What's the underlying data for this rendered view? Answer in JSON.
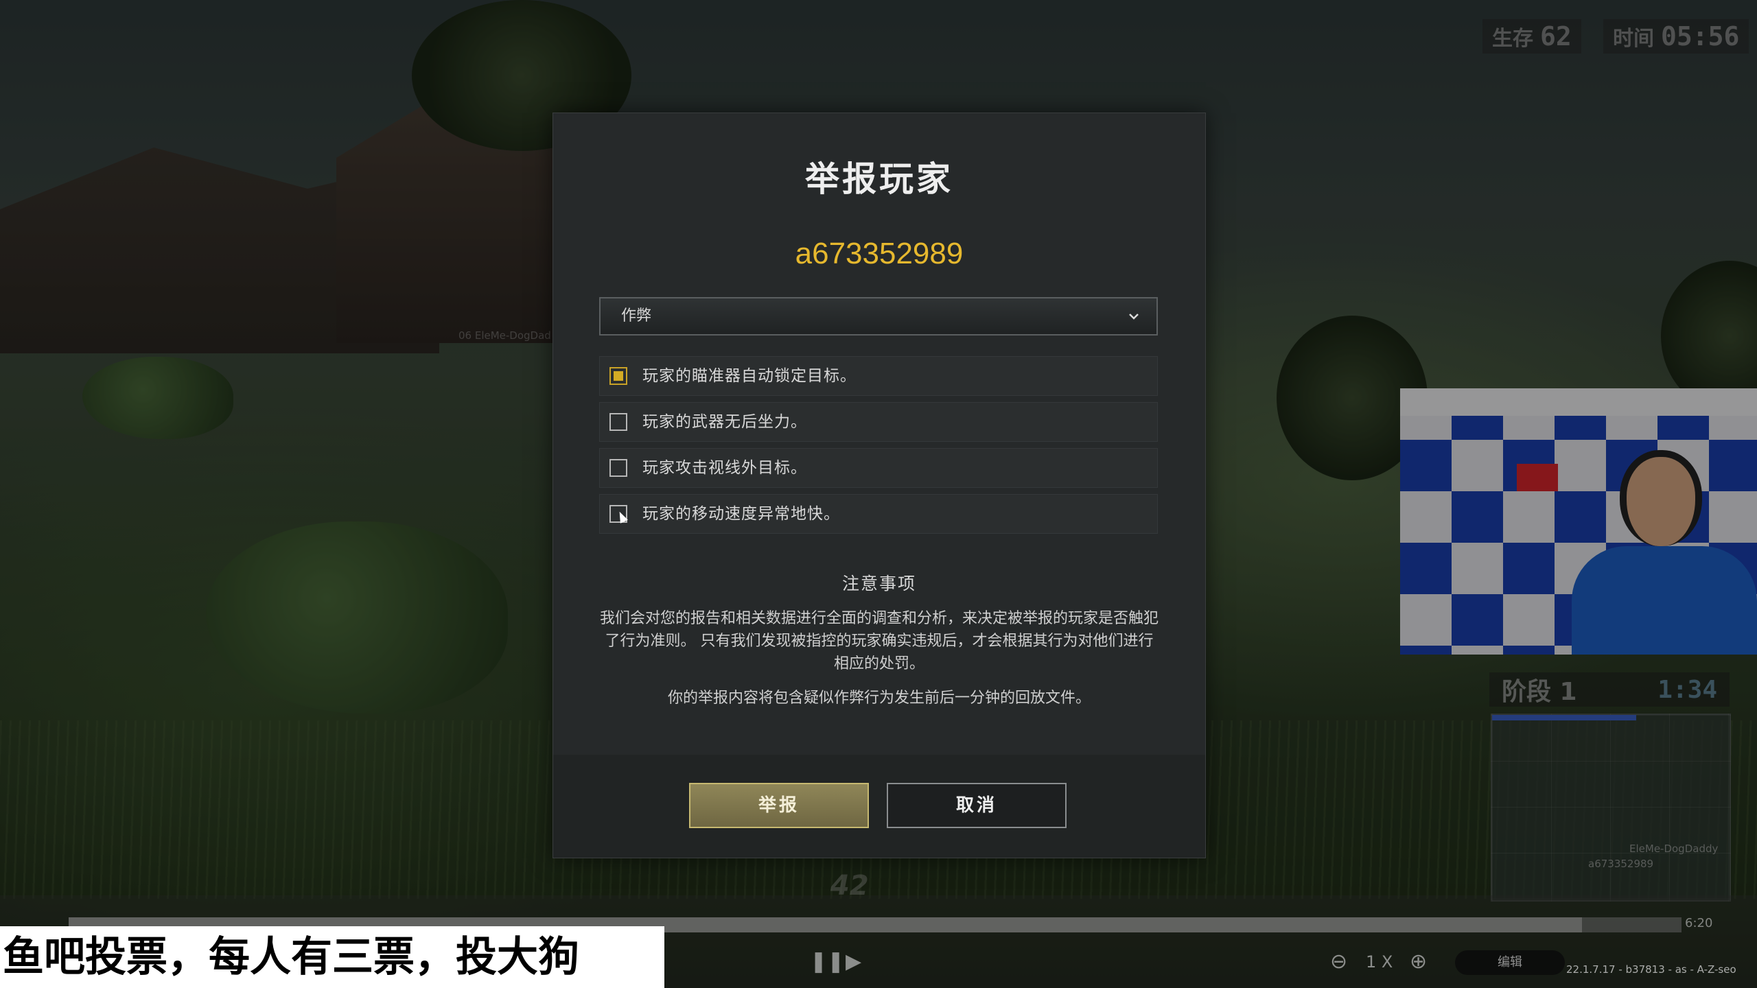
{
  "hud": {
    "alive_label": "生存",
    "alive_count": "62",
    "time_label": "时间",
    "time_value": "05:56",
    "teammate_name": "06  EleMe-DogDad",
    "ammo": "42"
  },
  "minimap": {
    "phase_label": "阶段 1",
    "phase_time": "1:34",
    "player_label_1": "EleMe-DogDaddy",
    "player_label_2": "a673352989"
  },
  "replay": {
    "end_time": "6:20",
    "zoom_label": "1 X",
    "edit_button": "编辑",
    "version": "22.1.7.17 - b37813 - as - A-Z-seo"
  },
  "caption": "鱼吧投票，每人有三票，投大狗",
  "report_dialog": {
    "title": "举报玩家",
    "player_name": "a673352989",
    "category": "作弊",
    "options": [
      {
        "label": "玩家的瞄准器自动锁定目标。",
        "checked": true
      },
      {
        "label": "玩家的武器无后坐力。",
        "checked": false
      },
      {
        "label": "玩家攻击视线外目标。",
        "checked": false
      },
      {
        "label": "玩家的移动速度异常地快。",
        "checked": false
      }
    ],
    "notice_title": "注意事项",
    "notice_body": "我们会对您的报告和相关数据进行全面的调查和分析，来决定被举报的玩家是否触犯了行为准则。 只有我们发现被指控的玩家确实违规后，才会根据其行为对他们进行相应的处罚。",
    "notice_extra": "你的举报内容将包含疑似作弊行为发生前后一分钟的回放文件。",
    "report_button": "举报",
    "cancel_button": "取消"
  },
  "colors": {
    "accent_gold": "#e6b82e",
    "checkbox_fill": "#d4ab24",
    "dialog_bg": "#26292a"
  }
}
